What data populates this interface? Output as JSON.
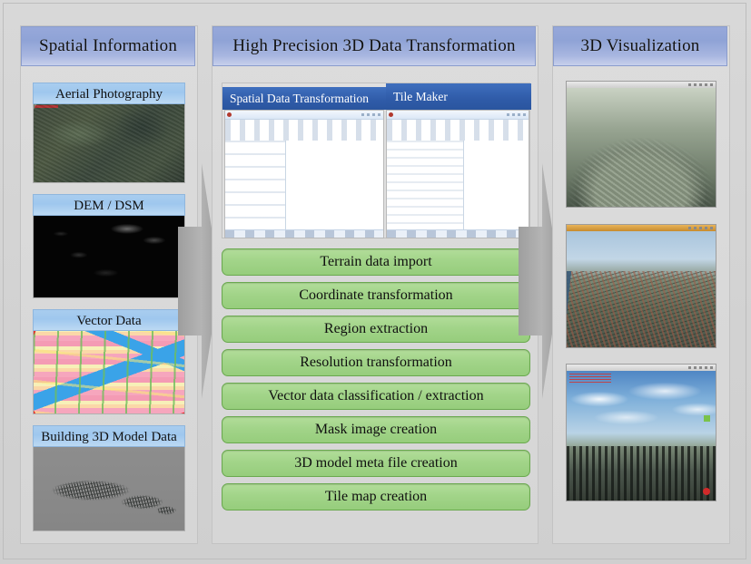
{
  "diagram": {
    "title": "3D spatial data processing pipeline",
    "colors": {
      "header_blue": "#8fa3d6",
      "card_label_blue": "#9fc7ee",
      "tab_blue": "#2f5ba8",
      "step_green": "#a2d489",
      "step_green_border": "#6aa94f",
      "background_gray": "#d4d4d4",
      "arrow_gray": "#a8a8a8"
    }
  },
  "columns": {
    "left": {
      "header": "Spatial Information",
      "cards": [
        {
          "label": "Aerial Photography",
          "image_name": "aerial-photo-thumbnail"
        },
        {
          "label": "DEM / DSM",
          "image_name": "dem-dsm-thumbnail"
        },
        {
          "label": "Vector Data",
          "image_name": "vector-data-thumbnail"
        },
        {
          "label": "Building 3D Model Data",
          "image_name": "building-3d-model-thumbnail"
        }
      ]
    },
    "middle": {
      "header": "High Precision 3D Data Transformation",
      "software_tabs": [
        {
          "label": "Spatial Data Transformation",
          "screenshot_name": "spatial-data-transformation-screenshot"
        },
        {
          "label": "Tile Maker",
          "screenshot_name": "tile-maker-screenshot"
        }
      ],
      "steps": [
        "Terrain data import",
        "Coordinate transformation",
        "Region extraction",
        "Resolution transformation",
        "Vector data classification / extraction",
        "Mask image creation",
        "3D model meta file creation",
        "Tile map creation"
      ]
    },
    "right": {
      "header": "3D Visualization",
      "views": [
        {
          "image_name": "terrain-3d-view"
        },
        {
          "image_name": "city-birdseye-3d-view"
        },
        {
          "image_name": "city-skyline-3d-view"
        }
      ]
    }
  },
  "arrows": [
    {
      "name": "arrow-left-to-middle",
      "direction": "right"
    },
    {
      "name": "arrow-middle-to-right",
      "direction": "right"
    }
  ]
}
